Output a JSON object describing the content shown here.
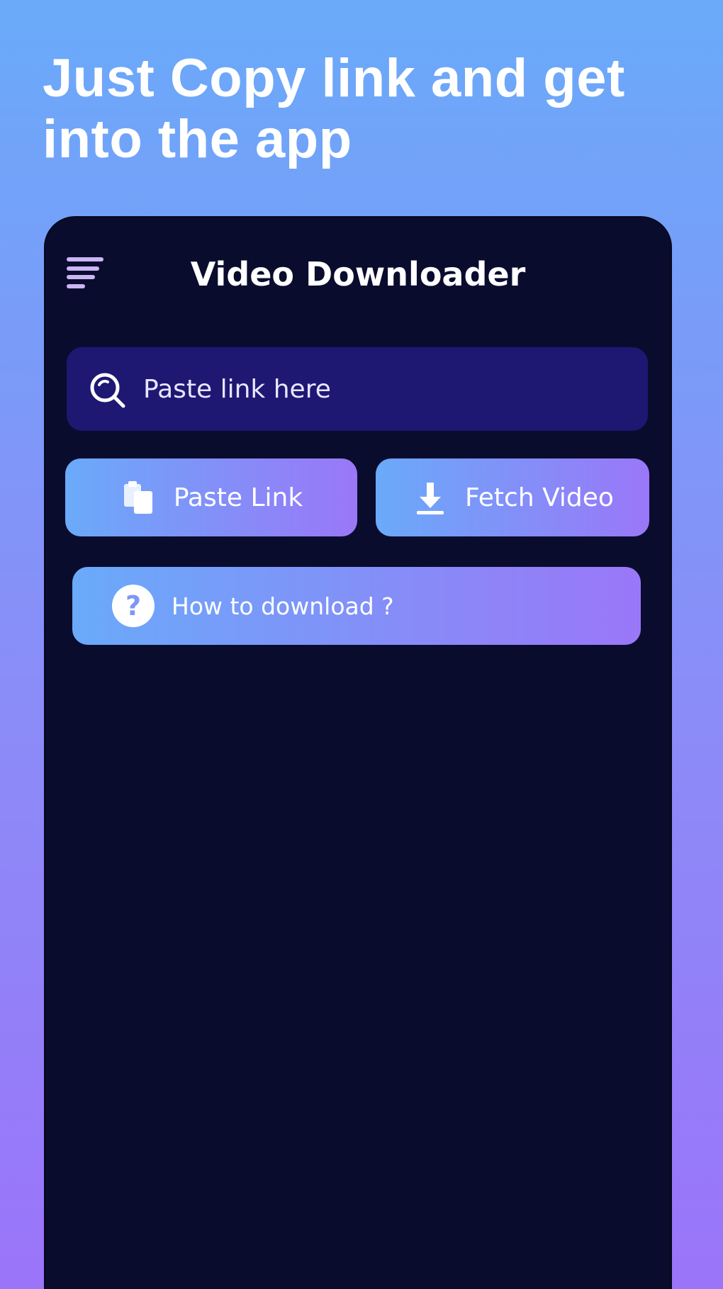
{
  "headline": "Just Copy link and get into the app",
  "app": {
    "title": "Video Downloader",
    "menu_icon": "hamburger-menu-icon"
  },
  "search": {
    "placeholder": "Paste link here",
    "icon": "search-icon"
  },
  "buttons": {
    "paste_link": "Paste Link",
    "fetch_video": "Fetch Video",
    "how_to": "How to download ?"
  },
  "colors": {
    "background_top": "#6aaaf9",
    "background_bottom": "#9b74f9",
    "phone_bg": "#0a0c2e",
    "search_bg": "#1e1873",
    "button_gradient_start": "#6aaaf9",
    "button_gradient_end": "#9a77f8"
  }
}
